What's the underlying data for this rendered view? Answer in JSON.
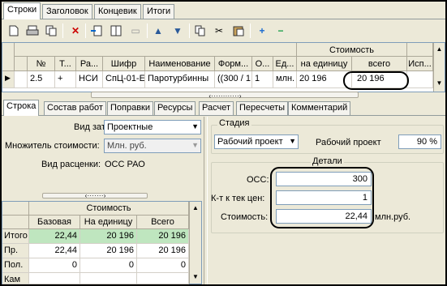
{
  "top_tabs": [
    "Строки",
    "Заголовок",
    "Концевик",
    "Итоги"
  ],
  "toolbar_icons": [
    "new-doc-icon",
    "print-icon",
    "copy-doc-icon",
    "delete-icon",
    "insert-row-icon",
    "insert-col-icon",
    "move-up-icon",
    "move-down-icon",
    "copy-icon",
    "cut-icon",
    "paste-icon",
    "expand-icon",
    "collapse-icon"
  ],
  "grid": {
    "group_header": "Стоимость",
    "columns": [
      "№",
      "Т...",
      "Ра...",
      "Шифр",
      "Наименование",
      "Форм...",
      "О...",
      "Ед...",
      "на единицу",
      "всего",
      "Исп..."
    ],
    "row": {
      "indicator": "▶",
      "num": "2.5",
      "type": "+",
      "section": "НСИ",
      "code": "СпЦ-01-Е",
      "name": "Паротурбинны",
      "formula": "((300 / 1",
      "o": "1",
      "unit": "млн.",
      "per_unit": "20 196",
      "total": "20 196",
      "extra": ""
    }
  },
  "detail_tabs": [
    "Строка",
    "Состав работ",
    "Поправки",
    "Ресурсы",
    "Расчет",
    "Пересчеты",
    "Комментарий"
  ],
  "left": {
    "cost_type_label": "Вид затрат:",
    "cost_type_value": "Проектные",
    "multiplier_label": "Множитель стоимости:",
    "multiplier_value": "Млн. руб.",
    "pricing_label": "Вид расценки:",
    "pricing_value": "ОСС РАО"
  },
  "stage": {
    "title": "Стадия",
    "select_value": "Рабочий проект",
    "text_value": "Рабочий проект",
    "percent": "90 %"
  },
  "details": {
    "title": "Детали",
    "occ_label": "ОСС:",
    "occ_value": "300",
    "coef_label": "К-т к тек цен:",
    "coef_value": "1",
    "cost_label": "Стоимость:",
    "cost_value": "22,44",
    "cost_unit": "млн.руб."
  },
  "bottom_grid": {
    "group_header": "Стоимость",
    "columns": [
      "",
      "Базовая",
      "На единицу",
      "Всего"
    ],
    "rows": [
      {
        "label": "Итого",
        "base": "22,44",
        "per_unit": "20 196",
        "total": "20 196"
      },
      {
        "label": "Пр.",
        "base": "22,44",
        "per_unit": "20 196",
        "total": "20 196"
      },
      {
        "label": "Пол.",
        "base": "0",
        "per_unit": "0",
        "total": "0"
      },
      {
        "label": "Кам",
        "base": "",
        "per_unit": "",
        "total": ""
      }
    ]
  }
}
